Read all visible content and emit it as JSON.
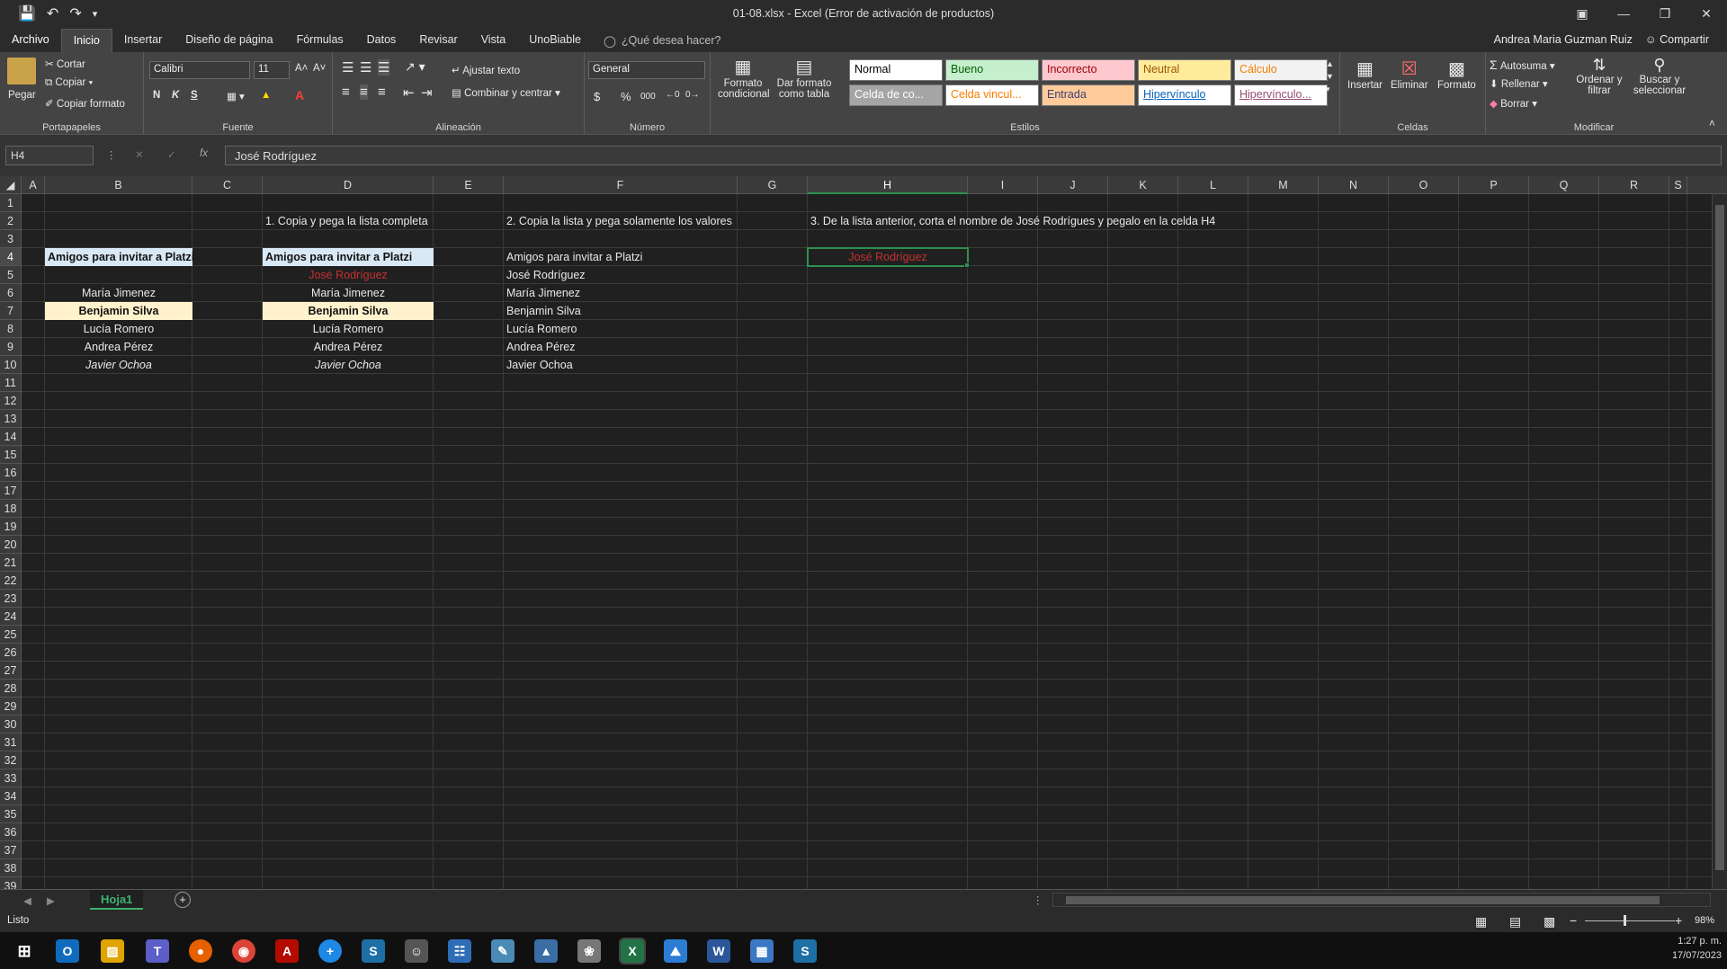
{
  "window": {
    "title": "01-08.xlsx - Excel (Error de activación de productos)"
  },
  "menu": {
    "file": "Archivo",
    "tabs": [
      "Inicio",
      "Insertar",
      "Diseño de página",
      "Fórmulas",
      "Datos",
      "Revisar",
      "Vista",
      "UnoBiable"
    ],
    "tell_me": "¿Qué desea hacer?",
    "user": "Andrea Maria Guzman Ruiz",
    "share": "Compartir"
  },
  "ribbon": {
    "clipboard": {
      "paste": "Pegar",
      "cut": "Cortar",
      "copy": "Copiar",
      "format_painter": "Copiar formato",
      "label": "Portapapeles"
    },
    "font": {
      "name": "Calibri",
      "size": "11",
      "bold": "N",
      "italic": "K",
      "underline": "S",
      "label": "Fuente"
    },
    "alignment": {
      "wrap": "Ajustar texto",
      "merge": "Combinar y centrar",
      "label": "Alineación"
    },
    "number": {
      "format": "General",
      "currency": "$",
      "percent": "%",
      "thousands": "000",
      "label": "Número"
    },
    "styles": {
      "conditional": "Formato condicional",
      "table": "Dar formato como tabla",
      "items": [
        {
          "label": "Normal",
          "bg": "#ffffff",
          "fg": "#000000"
        },
        {
          "label": "Bueno",
          "bg": "#c6efce",
          "fg": "#006100"
        },
        {
          "label": "Incorrecto",
          "bg": "#ffc7ce",
          "fg": "#9c0006"
        },
        {
          "label": "Neutral",
          "bg": "#ffeb9c",
          "fg": "#9c5700"
        },
        {
          "label": "Cálculo",
          "bg": "#f2f2f2",
          "fg": "#fa7d00"
        },
        {
          "label": "Celda de co...",
          "bg": "#a5a5a5",
          "fg": "#ffffff"
        },
        {
          "label": "Celda vincul...",
          "bg": "#ffffff",
          "fg": "#fa7d00"
        },
        {
          "label": "Entrada",
          "bg": "#ffcc99",
          "fg": "#3f3f76"
        },
        {
          "label": "Hipervínculo",
          "bg": "#ffffff",
          "fg": "#0563c1"
        },
        {
          "label": "Hipervínculo...",
          "bg": "#ffffff",
          "fg": "#954f72"
        }
      ],
      "label": "Estilos"
    },
    "cells": {
      "insert": "Insertar",
      "delete": "Eliminar",
      "format": "Formato",
      "label": "Celdas"
    },
    "editing": {
      "autosum": "Autosuma",
      "fill": "Rellenar",
      "clear": "Borrar",
      "sort": "Ordenar y filtrar",
      "find": "Buscar y seleccionar",
      "label": "Modificar"
    }
  },
  "formula_bar": {
    "name_box": "H4",
    "fx": "fx",
    "value": "José Rodríguez"
  },
  "sheet": {
    "columns": [
      "A",
      "B",
      "C",
      "D",
      "E",
      "F",
      "G",
      "H",
      "I",
      "J",
      "K",
      "L",
      "M",
      "N",
      "O",
      "P",
      "Q",
      "R",
      "S"
    ],
    "selected_column": "H",
    "selected_row": 4,
    "row_count": 39,
    "cells": {
      "D2": "1. Copia y pega la lista completa",
      "F2": "2. Copia la lista y pega solamente los valores",
      "H2": "3. De la lista anterior, corta el nombre de José Rodrígues y pegalo en la celda H4",
      "B4": "Amigos para invitar a Platzi",
      "D4": "Amigos para invitar a Platzi",
      "F4": "Amigos para invitar a Platzi",
      "H4": "José Rodríguez",
      "D5": "José Rodríguez",
      "F5": "José Rodríguez",
      "B6": "María Jimenez",
      "D6": "María Jimenez",
      "F6": "María Jimenez",
      "B7": "Benjamin Silva",
      "D7": "Benjamin Silva",
      "F7": "Benjamin Silva",
      "B8": "Lucía Romero",
      "D8": "Lucía Romero",
      "F8": "Lucía Romero",
      "B9": "Andrea Pérez",
      "D9": "Andrea Pérez",
      "F9": "Andrea Pérez",
      "B10": "Javier Ochoa",
      "D10": "Javier Ochoa",
      "F10": "Javier Ochoa"
    }
  },
  "sheet_tabs": {
    "active": "Hoja1",
    "add": "+"
  },
  "status": {
    "ready": "Listo",
    "zoom": "98%"
  },
  "taskbar": {
    "time": "1:27 p. m.",
    "date": "17/07/2023"
  },
  "colors": {
    "accent": "#2f8f4f",
    "excel_green": "#217346"
  }
}
